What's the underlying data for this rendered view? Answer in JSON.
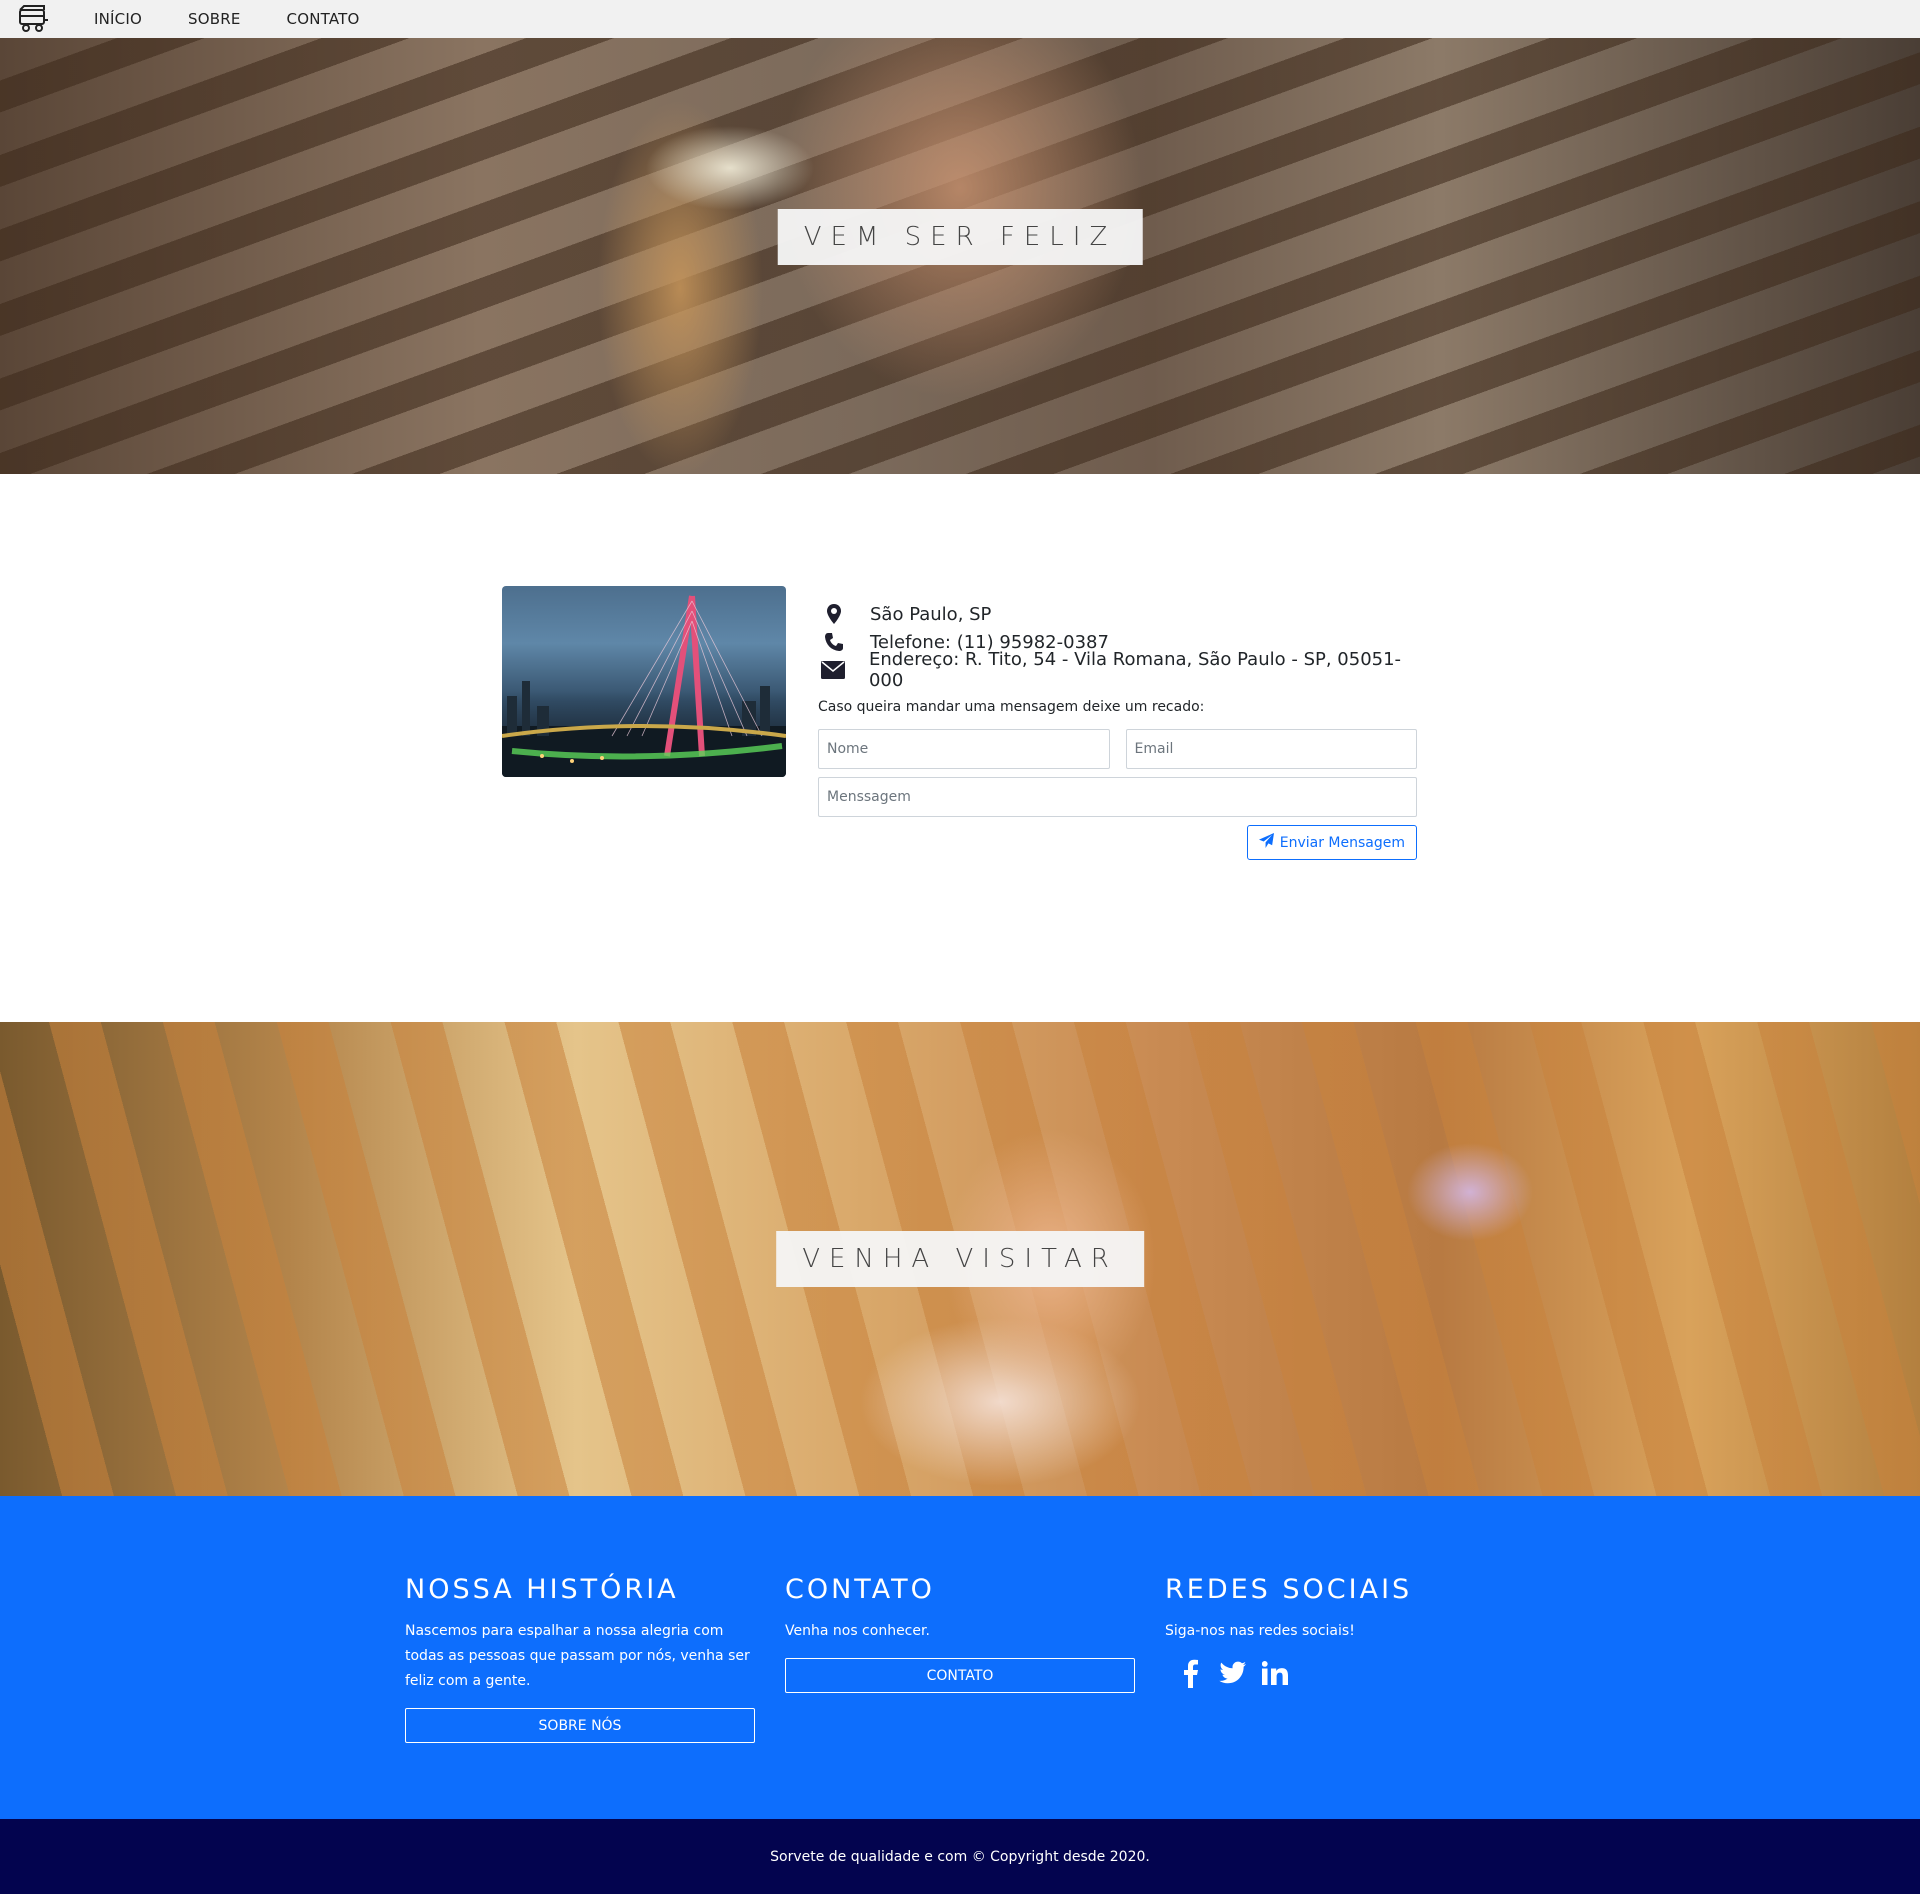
{
  "nav": {
    "logo_icon": "ice-cream-cart-icon",
    "links": [
      "INÍCIO",
      "SOBRE",
      "CONTATO"
    ]
  },
  "hero_top": {
    "caption": "VEM SER FELIZ"
  },
  "contact": {
    "city": "São Paulo, SP",
    "phone": "Telefone: (11) 95982-0387",
    "address": "Endereço: R. Tito, 54 - Vila Romana, São Paulo - SP, 05051-000",
    "icons": [
      "map-marker-icon",
      "phone-icon",
      "envelope-icon"
    ],
    "recado": "Caso queira mandar uma mensagem deixe um recado:",
    "form": {
      "name_placeholder": "Nome",
      "email_placeholder": "Email",
      "message_placeholder": "Menssagem",
      "send_label": "Enviar Mensagem"
    }
  },
  "hero_bottom": {
    "caption": "VENHA VISITAR"
  },
  "footer": {
    "history": {
      "title": "NOSSA HISTÓRIA",
      "text": "Nascemos para espalhar a nossa alegria com todas as pessoas que passam por nós, venha ser feliz com a gente.",
      "button": "SOBRE NÓS"
    },
    "contact": {
      "title": "CONTATO",
      "text": "Venha nos conhecer.",
      "button": "CONTATO"
    },
    "social": {
      "title": "REDES SOCIAIS",
      "text": "Siga-nos nas redes sociais!",
      "icons": [
        "facebook-icon",
        "twitter-icon",
        "linkedin-icon"
      ]
    },
    "copyright": "Sorvete de qualidade e com © Copyright desde 2020."
  },
  "colors": {
    "primary": "#0d6efd",
    "footer_dark": "#03044f",
    "nav_bg": "#f1f1f1"
  }
}
